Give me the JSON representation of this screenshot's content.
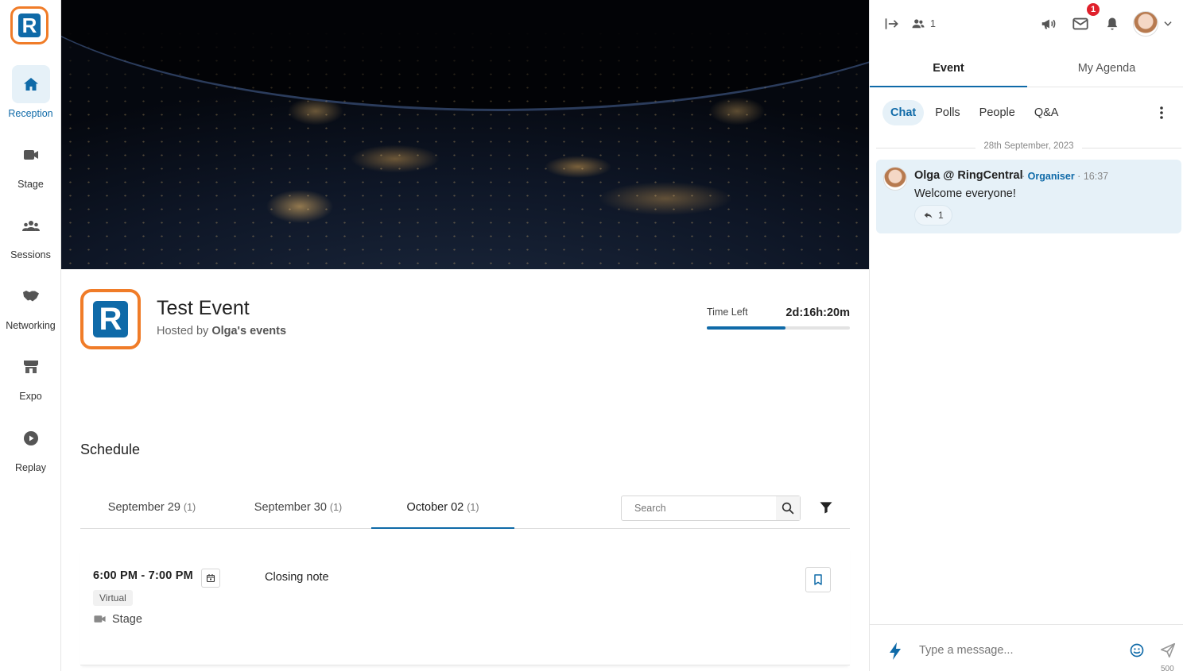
{
  "rail": {
    "logo_letter": "R",
    "items": [
      {
        "label": "Reception",
        "icon": "home-icon",
        "active": true
      },
      {
        "label": "Stage",
        "icon": "video-camera-icon",
        "active": false
      },
      {
        "label": "Sessions",
        "icon": "people-group-icon",
        "active": false
      },
      {
        "label": "Networking",
        "icon": "handshake-icon",
        "active": false
      },
      {
        "label": "Expo",
        "icon": "storefront-icon",
        "active": false
      },
      {
        "label": "Replay",
        "icon": "play-circle-icon",
        "active": false
      }
    ]
  },
  "event": {
    "logo_letter": "R",
    "title": "Test Event",
    "hosted_prefix": "Hosted by",
    "host": "Olga's events",
    "time_left_label": "Time Left",
    "time_left_value": "2d:16h:20m",
    "time_left_progress": 0.55
  },
  "schedule": {
    "title": "Schedule",
    "tabs": [
      {
        "label": "September 29",
        "count": "(1)",
        "active": false
      },
      {
        "label": "September 30",
        "count": "(1)",
        "active": false
      },
      {
        "label": "October 02",
        "count": "(1)",
        "active": true
      }
    ],
    "search_placeholder": "Search",
    "sessions": [
      {
        "time": "6:00 PM - 7:00 PM",
        "tag": "Virtual",
        "location": "Stage",
        "title": "Closing note"
      }
    ]
  },
  "right_panel": {
    "attendee_count": "1",
    "mail_badge": "1",
    "tabs": [
      {
        "label": "Event",
        "active": true
      },
      {
        "label": "My Agenda",
        "active": false
      }
    ],
    "subtabs": [
      {
        "label": "Chat",
        "active": true
      },
      {
        "label": "Polls",
        "active": false
      },
      {
        "label": "People",
        "active": false
      },
      {
        "label": "Q&A",
        "active": false
      }
    ],
    "date_separator": "28th September, 2023",
    "messages": [
      {
        "author": "Olga @ RingCentral",
        "role": "Organiser",
        "time": "16:37",
        "text": "Welcome everyone!",
        "reply_count": "1"
      }
    ],
    "composer_placeholder": "Type a message...",
    "char_limit": "500"
  },
  "colors": {
    "accent": "#0f6aa8",
    "brand_orange": "#f07c28",
    "badge_red": "#e0202b"
  }
}
